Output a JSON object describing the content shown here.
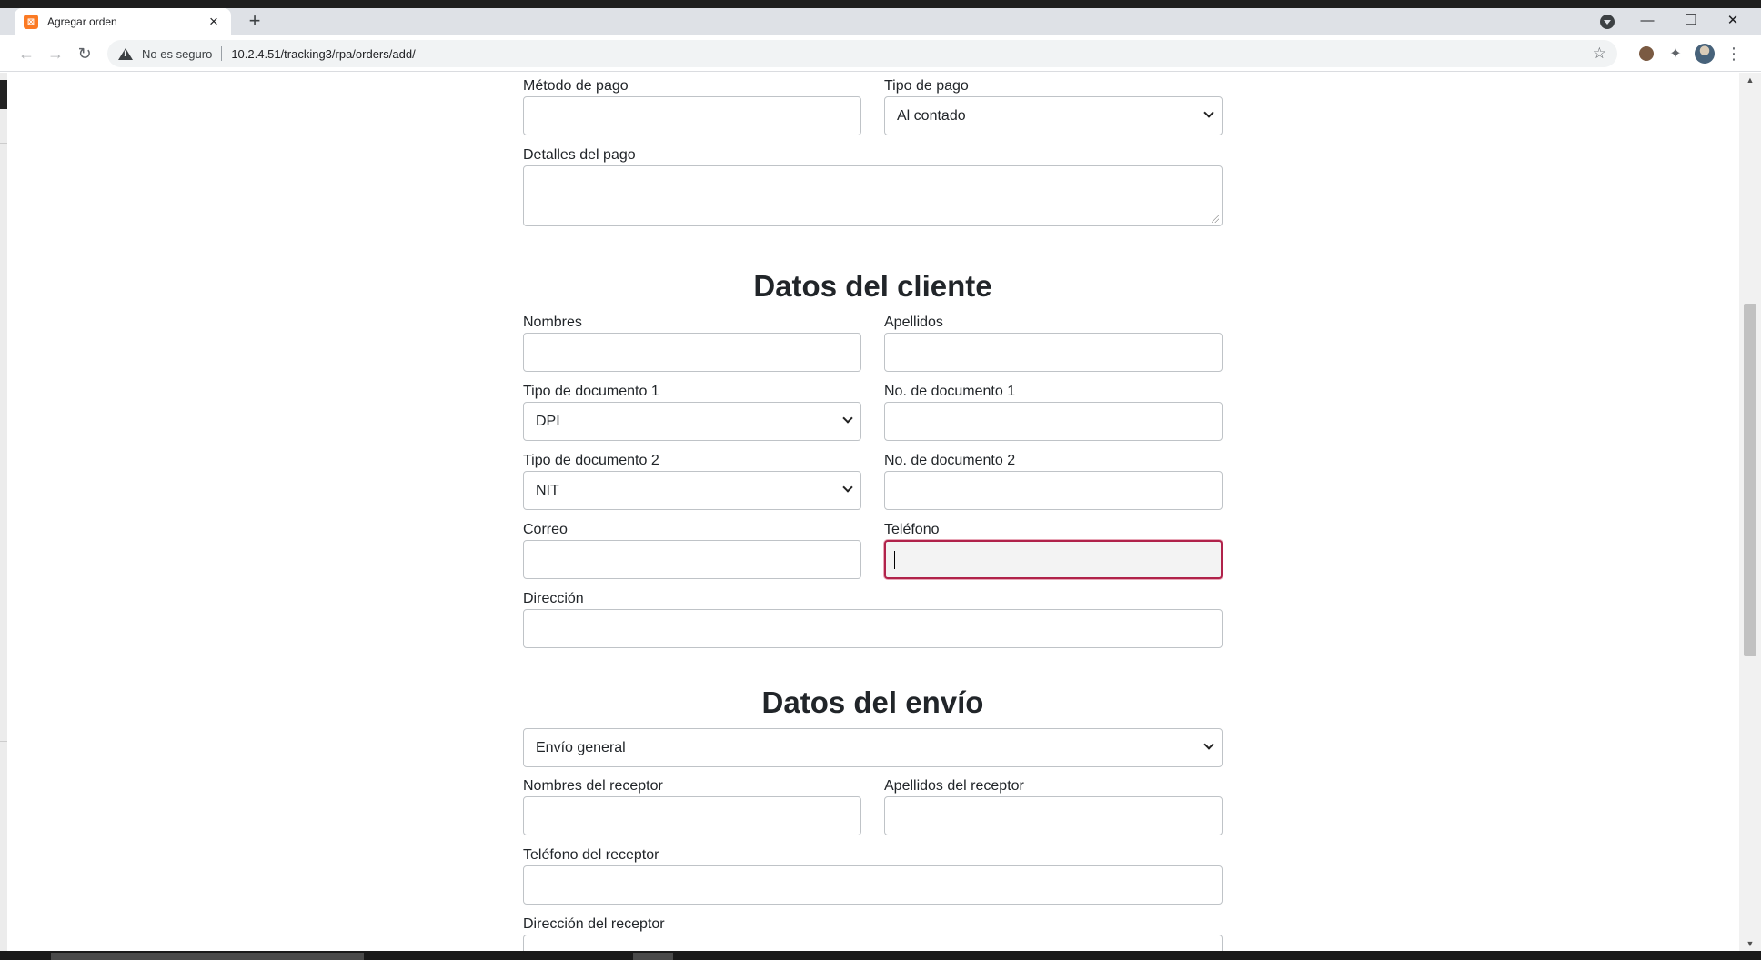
{
  "browser": {
    "tab_title": "Agregar orden",
    "tab_favicon": "xampp-icon",
    "new_tab": "+",
    "security_label": "No es seguro",
    "url": "10.2.4.51/tracking3/rpa/orders/add/",
    "minimize": "—",
    "restore": "❐",
    "close": "✕"
  },
  "payment": {
    "metodo_label": "Método de pago",
    "metodo_value": "",
    "tipo_label": "Tipo de pago",
    "tipo_value": "Al contado",
    "detalles_label": "Detalles del pago",
    "detalles_value": ""
  },
  "client": {
    "title": "Datos del cliente",
    "nombres_label": "Nombres",
    "apellidos_label": "Apellidos",
    "tipo_doc1_label": "Tipo de documento 1",
    "tipo_doc1_value": "DPI",
    "no_doc1_label": "No. de documento 1",
    "tipo_doc2_label": "Tipo de documento 2",
    "tipo_doc2_value": "NIT",
    "no_doc2_label": "No. de documento 2",
    "correo_label": "Correo",
    "telefono_label": "Teléfono",
    "direccion_label": "Dirección"
  },
  "shipping": {
    "title": "Datos del envío",
    "tipo_envio_value": "Envío general",
    "nombres_receptor_label": "Nombres del receptor",
    "apellidos_receptor_label": "Apellidos del receptor",
    "telefono_receptor_label": "Teléfono del receptor",
    "direccion_receptor_label": "Dirección del receptor"
  },
  "colors": {
    "focus_border": "#b0224a",
    "tab_strip": "#dee1e6",
    "input_border": "#bfc3c7"
  }
}
